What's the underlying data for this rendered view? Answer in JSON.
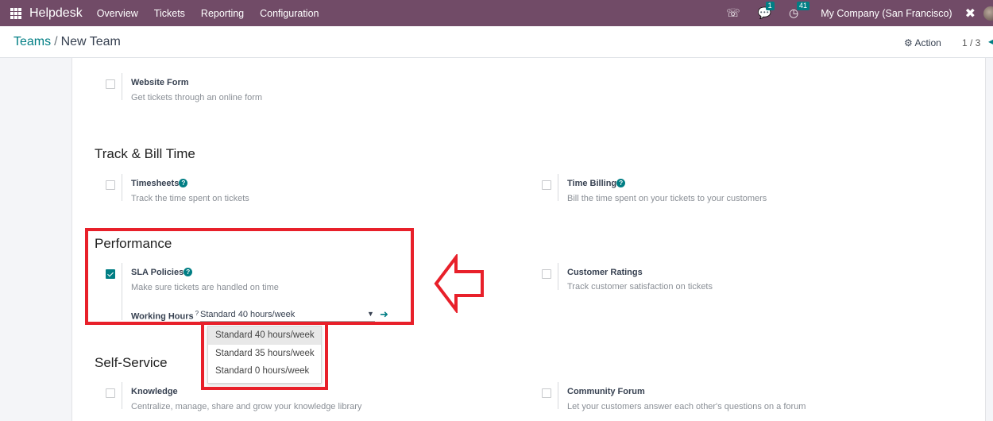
{
  "navbar": {
    "apps_icon": "grid-icon",
    "brand": "Helpdesk",
    "menu": [
      "Overview",
      "Tickets",
      "Reporting",
      "Configuration"
    ],
    "phone_icon": "phone-icon",
    "messages_icon": "chat-icon",
    "messages_count": "1",
    "activities_icon": "clock-icon",
    "activities_count": "41",
    "company": "My Company (San Francisco)",
    "debug_icon": "tools-icon"
  },
  "control": {
    "breadcrumb_parent": "Teams",
    "breadcrumb_sep": "/",
    "breadcrumb_current": "New Team",
    "action_label": "Action",
    "action_icon": "gear-icon",
    "pager": "1 / 3"
  },
  "sections": {
    "website_form": {
      "title": "Website Form",
      "desc": "Get tickets through an online form",
      "checked": false
    },
    "track_bill": {
      "heading": "Track & Bill Time",
      "timesheets": {
        "title": "Timesheets",
        "desc": "Track the time spent on tickets",
        "checked": false
      },
      "time_billing": {
        "title": "Time Billing",
        "desc": "Bill the time spent on your tickets to your customers",
        "checked": false
      }
    },
    "performance": {
      "heading": "Performance",
      "sla": {
        "title": "SLA Policies",
        "desc": "Make sure tickets are handled on time",
        "checked": true
      },
      "working_hours_label": "Working Hours",
      "working_hours_help": "?",
      "working_hours_value": "Standard 40 hours/week",
      "working_hours_options": [
        "Standard 40 hours/week",
        "Standard 35 hours/week",
        "Standard 0 hours/week"
      ],
      "customer_ratings": {
        "title": "Customer Ratings",
        "desc": "Track customer satisfaction on tickets",
        "checked": false
      }
    },
    "self_service": {
      "heading": "Self-Service",
      "knowledge": {
        "title": "Knowledge",
        "desc": "Centralize, manage, share and grow your knowledge library",
        "checked": false
      },
      "community_forum": {
        "title": "Community Forum",
        "desc": "Let your customers answer each other's questions on a forum",
        "checked": false
      }
    }
  },
  "annotation": {
    "color": "#e8202a"
  },
  "colors": {
    "navbar": "#714b67",
    "accent": "#017e84"
  }
}
